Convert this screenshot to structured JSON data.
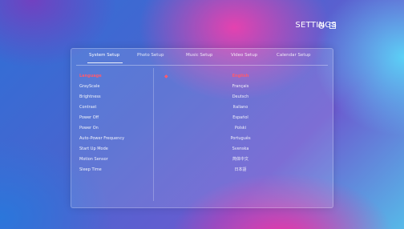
{
  "header": {
    "title": "SETTINGS"
  },
  "tabs": [
    {
      "label": "System Setup"
    },
    {
      "label": "Photo Setup"
    },
    {
      "label": "Music Setup"
    },
    {
      "label": "Video Setup"
    },
    {
      "label": "Calendar Setup"
    }
  ],
  "menu": [
    {
      "label": "Language"
    },
    {
      "label": "GrayScale"
    },
    {
      "label": "Brightness"
    },
    {
      "label": "Contrast"
    },
    {
      "label": "Power Off"
    },
    {
      "label": "Power On"
    },
    {
      "label": "Auto-Power Frequency"
    },
    {
      "label": "Start Up Mode"
    },
    {
      "label": "Motion Sensor"
    },
    {
      "label": "Sleep Time"
    }
  ],
  "languages": [
    {
      "label": "English"
    },
    {
      "label": "Français"
    },
    {
      "label": "Deutsch"
    },
    {
      "label": "Italiano"
    },
    {
      "label": "Español"
    },
    {
      "label": "Polski"
    },
    {
      "label": "Português"
    },
    {
      "label": "Svenska"
    },
    {
      "label": "简体中文"
    },
    {
      "label": "日本語"
    }
  ],
  "selection": {
    "marker": "◆"
  },
  "colors": {
    "accent": "#ff5a6e"
  },
  "icons": {
    "settings": "gear-icon",
    "exit": "exit-icon"
  }
}
